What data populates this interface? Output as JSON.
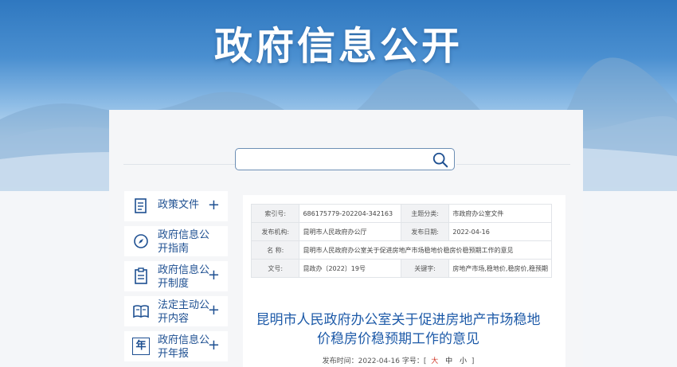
{
  "header": {
    "title": "政府信息公开"
  },
  "search": {
    "placeholder": ""
  },
  "sidebar": {
    "items": [
      {
        "label": "政策文件",
        "icon": "document-icon",
        "expandable": true
      },
      {
        "label": "政府信息公开指南",
        "icon": "compass-icon",
        "expandable": false
      },
      {
        "label": "政府信息公开制度",
        "icon": "clipboard-icon",
        "expandable": true
      },
      {
        "label": "法定主动公开内容",
        "icon": "book-icon",
        "expandable": true
      },
      {
        "label": "政府信息公开年报",
        "icon": "year-icon",
        "icon_text": "年",
        "expandable": true
      }
    ]
  },
  "meta": {
    "index_label": "索引号:",
    "index_value": "686175779-202204-342163",
    "topic_label": "主题分类:",
    "topic_value": "市政府办公室文件",
    "issuer_label": "发布机构:",
    "issuer_value": "昆明市人民政府办公厅",
    "date_label": "发布日期:",
    "date_value": "2022-04-16",
    "name_label": "名    称:",
    "name_value": "昆明市人民政府办公室关于促进房地产市场稳地价稳房价稳预期工作的意见",
    "docno_label": "文号:",
    "docno_value": "昆政办〔2022〕19号",
    "keyword_label": "关键字:",
    "keyword_value": "房地产市场,稳地价,稳房价,稳预期"
  },
  "article": {
    "title_line1": "昆明市人民政府办公室关于促进房地产市场稳地",
    "title_line2": "价稳房价稳预期工作的意见",
    "pub_time_label": "发布时间：",
    "pub_time": "2022-04-16",
    "font_label": "字号：[",
    "font_large": "大",
    "font_medium": "中",
    "font_small": "小",
    "font_close": "]"
  },
  "colors": {
    "accent": "#1d4f91",
    "title": "#1d5aa8",
    "highlight": "#d03a2b"
  }
}
